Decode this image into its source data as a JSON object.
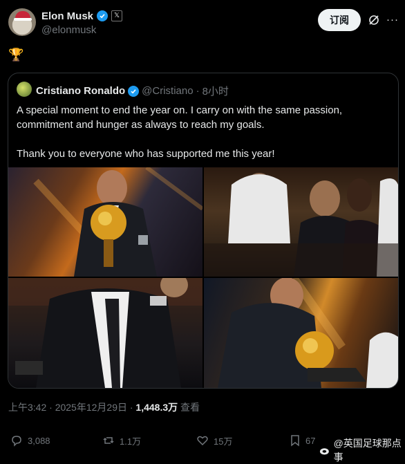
{
  "author": {
    "name": "Elon Musk",
    "handle": "@elonmusk",
    "badge": "𝕏"
  },
  "header": {
    "subscribe_label": "订阅",
    "more_glyph": "···"
  },
  "tweet": {
    "emoji": "🏆"
  },
  "quote": {
    "name": "Cristiano Ronaldo",
    "handle": "@Cristiano",
    "separator": "·",
    "time": "8小时",
    "paragraph_1": "A special moment to end the year on. I carry on with the same passion, commitment and hunger as always to reach my goals.",
    "paragraph_2": "Thank you to everyone who has supported me this year!"
  },
  "meta": {
    "time": "上午3:42 · 2025年12月29日 ·",
    "views": "1,448.3万",
    "views_label": "查看"
  },
  "actions": {
    "replies": "3,088",
    "reposts": "1.1万",
    "likes": "15万",
    "bookmarks": "67"
  },
  "watermark": {
    "text": "@英国足球那点事"
  },
  "colors": {
    "background": "#000000",
    "text": "#e7e9ea",
    "muted": "#71767b",
    "verified": "#1d9bf0",
    "border": "#2f3336"
  }
}
